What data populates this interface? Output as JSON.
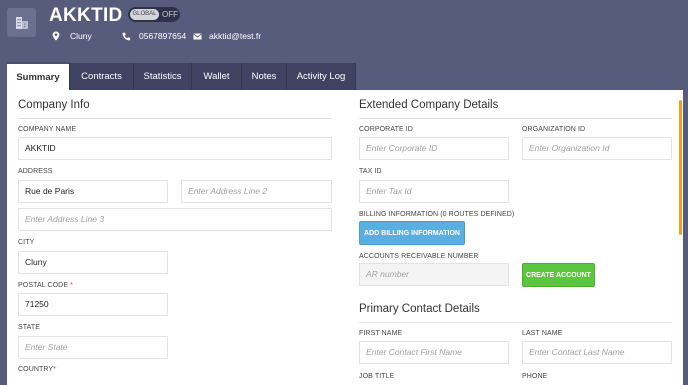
{
  "header": {
    "company_name": "AKKTID",
    "toggle_on_label": "GLOBAL",
    "toggle_off_label": "OFF",
    "location": "Cluny",
    "phone": "0567897654",
    "email": "akktid@test.fr"
  },
  "tabs": [
    {
      "label": "Summary",
      "active": true
    },
    {
      "label": "Contracts",
      "active": false
    },
    {
      "label": "Statistics",
      "active": false
    },
    {
      "label": "Wallet",
      "active": false
    },
    {
      "label": "Notes",
      "active": false
    },
    {
      "label": "Activity Log",
      "active": false
    }
  ],
  "company_info": {
    "title": "Company Info",
    "company_name_label": "COMPANY NAME",
    "company_name_value": "AKKTID",
    "address_label": "ADDRESS",
    "address_line1_value": "Rue de Paris",
    "address_line2_placeholder": "Enter Address Line 2",
    "address_line3_placeholder": "Enter Address Line 3",
    "city_label": "CITY",
    "city_value": "Cluny",
    "postal_code_label": "POSTAL CODE",
    "postal_code_value": "71250",
    "state_label": "STATE",
    "state_placeholder": "Enter State",
    "country_label": "COUNTRY",
    "required_mark": "*"
  },
  "extended": {
    "title": "Extended Company Details",
    "corporate_id_label": "CORPORATE ID",
    "corporate_id_placeholder": "Enter Corporate ID",
    "organization_id_label": "ORGANIZATION ID",
    "organization_id_placeholder": "Enter Organization Id",
    "tax_id_label": "TAX ID",
    "tax_id_placeholder": "Enter Tax Id",
    "billing_label": "BILLING INFORMATION (0 ROUTES DEFINED)",
    "billing_button": "ADD BILLING INFORMATION",
    "ar_label": "ACCOUNTS RECEIVABLE NUMBER",
    "ar_placeholder": "AR number",
    "create_account_button": "CREATE ACCOUNT"
  },
  "primary_contact": {
    "title": "Primary Contact Details",
    "first_name_label": "FIRST NAME",
    "first_name_placeholder": "Enter Contact First Name",
    "last_name_label": "LAST NAME",
    "last_name_placeholder": "Enter Contact Last Name",
    "job_title_label": "JOB TITLE",
    "phone_label": "PHONE"
  },
  "colors": {
    "background": "#575c7d",
    "tab_bg": "#3f4361",
    "blue_button": "#5aaee0",
    "green_button": "#5cc63e",
    "scroll_accent": "#f0a020"
  }
}
